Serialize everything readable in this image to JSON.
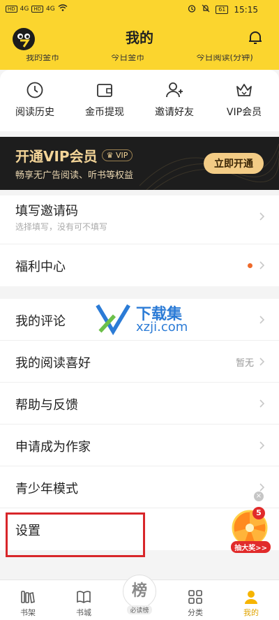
{
  "status_bar": {
    "sim1": "HD",
    "sim2": "HD",
    "signal1": "4G",
    "signal2": "4G",
    "battery": "61",
    "time": "15:15"
  },
  "header": {
    "title": "我的",
    "stats": [
      "我的金币",
      "今日金币",
      "今日阅读(分钟)"
    ]
  },
  "shortcuts": [
    {
      "label": "阅读历史",
      "icon": "clock-icon"
    },
    {
      "label": "金币提现",
      "icon": "wallet-icon"
    },
    {
      "label": "邀请好友",
      "icon": "add-user-icon"
    },
    {
      "label": "VIP会员",
      "icon": "crown-icon"
    }
  ],
  "vip_banner": {
    "title": "开通VIP会员",
    "tag": "VIP",
    "subtitle": "畅享无广告阅读、听书等权益",
    "button": "立即开通"
  },
  "section1": [
    {
      "label": "填写邀请码",
      "sub": "选择填写，没有可不填写"
    },
    {
      "label": "福利中心"
    }
  ],
  "section2": [
    {
      "label": "我的评论"
    },
    {
      "label": "我的阅读喜好",
      "value": "暂无"
    },
    {
      "label": "帮助与反馈"
    },
    {
      "label": "申请成为作家"
    },
    {
      "label": "青少年模式"
    },
    {
      "label": "设置"
    }
  ],
  "lottery": {
    "badge": "5",
    "label": "抽大奖>>",
    "close": "×"
  },
  "watermark": {
    "text": "下载集",
    "url": "xzji.com"
  },
  "tabbar": [
    {
      "label": "书架",
      "icon": "bookshelf-icon"
    },
    {
      "label": "书城",
      "icon": "book-icon"
    },
    {
      "label": "必读榜",
      "icon": "rank-icon",
      "glyph": "榜"
    },
    {
      "label": "分类",
      "icon": "grid-icon"
    },
    {
      "label": "我的",
      "icon": "user-icon"
    }
  ],
  "colors": {
    "header_bg": "#fbd52e",
    "vip_bg": "#1d1d1d",
    "vip_gold": "#f4d598",
    "active_tab": "#e0a400",
    "highlight": "#d8262a"
  }
}
